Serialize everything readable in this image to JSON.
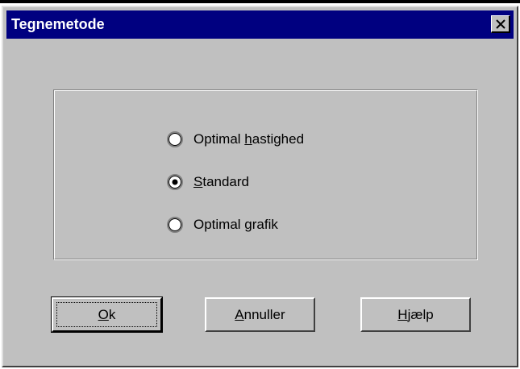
{
  "window": {
    "title": "Tegnemetode"
  },
  "options": [
    {
      "label": "Optimal hastighed",
      "pre": "Optimal ",
      "mnemonic": "h",
      "post": "astighed",
      "selected": false
    },
    {
      "label": "Standard",
      "pre": "",
      "mnemonic": "S",
      "post": "tandard",
      "selected": true
    },
    {
      "label": "Optimal grafik",
      "pre": "Optimal ",
      "mnemonic": "g",
      "post": "rafik",
      "selected": false
    }
  ],
  "buttons": {
    "ok": {
      "label": "Ok",
      "mnemonic": "O",
      "rest": "k"
    },
    "cancel": {
      "label": "Annuller",
      "mnemonic": "A",
      "rest": "nnuller"
    },
    "help": {
      "label": "Hjælp",
      "mnemonic": "H",
      "rest": "jælp"
    }
  },
  "colors": {
    "titlebar": "#000080",
    "face": "#c0c0c0"
  },
  "icons": {
    "close": "close-icon"
  }
}
